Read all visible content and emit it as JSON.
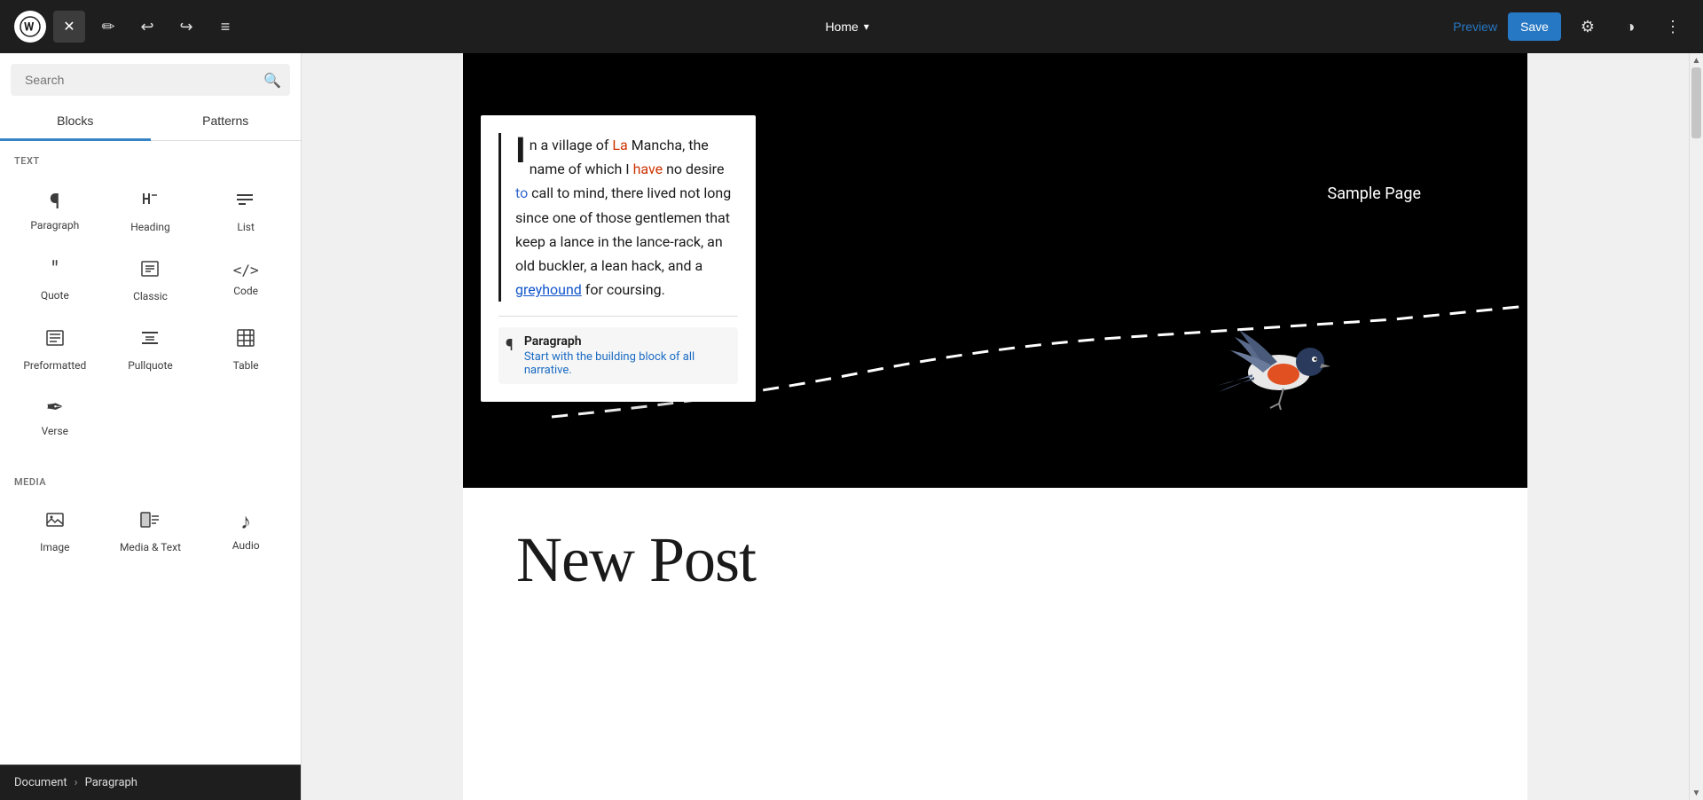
{
  "toolbar": {
    "close_label": "✕",
    "undo_label": "↩",
    "redo_label": "↪",
    "menu_label": "≡",
    "page_title": "Home",
    "preview_label": "Preview",
    "save_label": "Save",
    "settings_icon": "⚙",
    "contrast_icon": "◑",
    "more_icon": "⋮"
  },
  "sidebar": {
    "search_placeholder": "Search",
    "tabs": [
      {
        "id": "blocks",
        "label": "Blocks",
        "active": true
      },
      {
        "id": "patterns",
        "label": "Patterns",
        "active": false
      }
    ],
    "section_text": {
      "label": "TEXT",
      "media_label": "MEDIA"
    },
    "blocks": [
      {
        "id": "paragraph",
        "icon": "¶",
        "label": "Paragraph"
      },
      {
        "id": "heading",
        "icon": "🔖",
        "label": "Heading"
      },
      {
        "id": "list",
        "icon": "≡",
        "label": "List"
      },
      {
        "id": "quote",
        "icon": "❝",
        "label": "Quote"
      },
      {
        "id": "classic",
        "icon": "⌨",
        "label": "Classic"
      },
      {
        "id": "code",
        "icon": "<>",
        "label": "Code"
      },
      {
        "id": "preformatted",
        "icon": "▤",
        "label": "Preformatted"
      },
      {
        "id": "pullquote",
        "icon": "▬",
        "label": "Pullquote"
      },
      {
        "id": "table",
        "icon": "⊞",
        "label": "Table"
      },
      {
        "id": "verse",
        "icon": "✒",
        "label": "Verse"
      }
    ],
    "media_blocks": [
      {
        "id": "image",
        "icon": "🖼",
        "label": "Image"
      },
      {
        "id": "media-text",
        "icon": "▧",
        "label": "Media & Text"
      },
      {
        "id": "audio",
        "icon": "♪",
        "label": "Audio"
      }
    ]
  },
  "breadcrumb": {
    "document_label": "Document",
    "separator": "›",
    "paragraph_label": "Paragraph"
  },
  "canvas": {
    "sample_page": "Sample Page",
    "new_post": "New Post",
    "body_text": "n a village of La Mancha, the name of which I have no desire to call to mind, there lived not long since one of those gentlemen that keep a lance in the lance-rack, an old buckler, a lean hack, and a greyhound for coursing.",
    "popup_heading": "Paragraph",
    "popup_subtext": "Start with the building block of all narrative."
  },
  "colors": {
    "active_tab": "#3582c4",
    "save_btn": "#2778c4",
    "preview_text": "#2778c4",
    "toolbar_bg": "#1e1e1e",
    "hero_bg": "#000000"
  }
}
